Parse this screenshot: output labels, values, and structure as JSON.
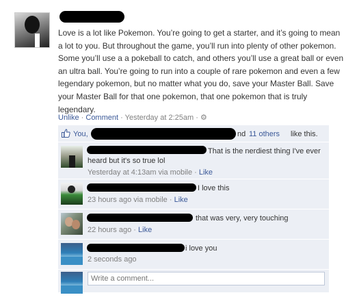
{
  "post": {
    "body": "Love is a lot like Pokemon. You’re going to get a starter, and it’s going to mean a lot to you. But throughout the game, you’ll run into plenty of other pokemon. Some you’ll use a a pokeball to catch, and others you’ll use a great ball or even an ultra ball. You’re going to run into a couple of rare pokemon and even a few legendary pokemon, but no matter what you do, save your Master Ball. Save your Master Ball for that one pokemon, that one pokemon that is truly legendary.",
    "unlike_label": "Unlike",
    "comment_label": "Comment",
    "timestamp": "Yesterday at 2:25am",
    "separator": "·"
  },
  "likes": {
    "you_label": "You,",
    "and_label": "nd",
    "others_link": "11 others",
    "suffix": "like this."
  },
  "comments": [
    {
      "text": "That is the nerdiest thing I've ever heard but it's so true lol",
      "meta": "Yesterday at 4:13am via mobile",
      "like_label": "Like"
    },
    {
      "text": "I love this",
      "meta": "23 hours ago via mobile",
      "like_label": "Like"
    },
    {
      "text": "that was very, very touching",
      "meta": "22 hours ago",
      "like_label": "Like"
    },
    {
      "text": "i love you",
      "meta": "2 seconds ago"
    }
  ],
  "comment_box": {
    "placeholder": "Write a comment..."
  },
  "colors": {
    "link": "#3b5998",
    "ufi_bg": "#eceff5",
    "meta_grey": "#808080"
  }
}
